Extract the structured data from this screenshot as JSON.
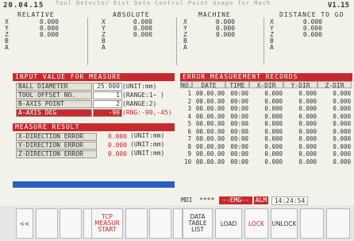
{
  "top": {
    "date": "20.04.15",
    "version": "V1.15",
    "faint_text": "Tool Detector Dist Data Control Point Usage for Mach"
  },
  "positions": {
    "headers": [
      "RELATIVE",
      "ABSOLUTE",
      "MACHINE",
      "DISTANCE TO GO"
    ],
    "axes": [
      "X",
      "Y",
      "Z",
      "B",
      "A"
    ],
    "values": [
      "0.000",
      "0.000",
      "0.000"
    ]
  },
  "input": {
    "title": "INPUT VALUE FOR MEASURE",
    "rows": [
      {
        "label": "BALL DIAMETER",
        "value": "25.000",
        "unit": "(UNIT:mm)"
      },
      {
        "label": "TOOL OFFSET NO.",
        "value": "1",
        "unit": "(RANGE:1~ )"
      },
      {
        "label": "B-AXIS POINT",
        "value": "2",
        "unit": "(RANGE:2)"
      },
      {
        "label": "A-AXIS DEG",
        "value": "-90",
        "unit": "(RNG:-90,-45)"
      }
    ]
  },
  "result": {
    "title": "MEASURE RESULT",
    "rows": [
      {
        "label": "X-DIRECTION ERROR",
        "value": "0.000",
        "unit": "(UNIT:mm)"
      },
      {
        "label": "Y-DIRECTION ERROR",
        "value": "0.000",
        "unit": "(UNIT:mm)"
      },
      {
        "label": "Z-DIRECTION ERROR",
        "value": "0.000",
        "unit": "(UNIT:mm)"
      }
    ]
  },
  "records": {
    "title": "ERROR MEASUREMENT RECORDS",
    "headers": [
      "NO.",
      "DATE",
      "TIME",
      "X-DIR",
      "Y-DIR",
      "Z-DIR"
    ],
    "date": "00.00.00",
    "time": "00:00",
    "value": "0.000",
    "nums": [
      "1",
      "2",
      "3",
      "4",
      "5",
      "6",
      "7",
      "8",
      "9",
      "10"
    ]
  },
  "status": {
    "mode": "MDI",
    "stars": "****",
    "emg": "--EMG--",
    "alm": "ALM",
    "clock": "14:24:54"
  },
  "softkeys": [
    "<<",
    "",
    "",
    "",
    "TCP MEASUR START",
    "",
    "",
    "",
    "DATA TABLE LIST",
    "LOAD",
    "LOCK",
    "UNLOCK",
    "",
    ""
  ],
  "colors": {
    "accent_red": "#c72a2e",
    "blue_bar": "#2a5ec4"
  }
}
